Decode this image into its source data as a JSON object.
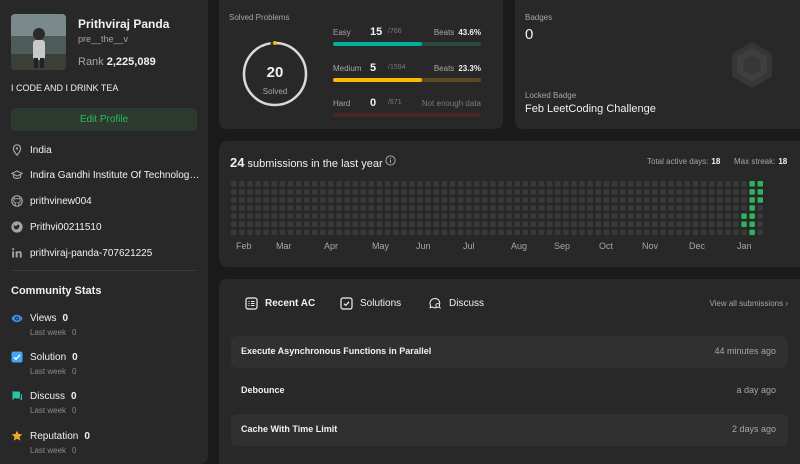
{
  "profile": {
    "name": "Prithviraj Panda",
    "handle": "pre__the__v",
    "rank_label": "Rank",
    "rank_value": "2,225,089",
    "bio": "I CODE AND I DRINK TEA",
    "edit_label": "Edit Profile",
    "location": "India",
    "school": "Indira Gandhi Institute Of Technology...",
    "github": "prithvinew004",
    "twitter": "Prithvi00211510",
    "linkedin": "prithviraj-panda-707621225"
  },
  "community": {
    "title": "Community Stats",
    "stats": [
      {
        "label": "Views",
        "value": "0",
        "sub": "Last week",
        "sub_value": "0",
        "icon": "eye-icon",
        "color": "#3b8ce8"
      },
      {
        "label": "Solution",
        "value": "0",
        "sub": "Last week",
        "sub_value": "0",
        "icon": "checkbox-icon",
        "color": "#42a5f5"
      },
      {
        "label": "Discuss",
        "value": "0",
        "sub": "Last week",
        "sub_value": "0",
        "icon": "chat-icon",
        "color": "#2dc3a5"
      },
      {
        "label": "Reputation",
        "value": "0",
        "sub": "Last week",
        "sub_value": "0",
        "icon": "star-icon",
        "color": "#f5a623"
      }
    ]
  },
  "solved": {
    "title": "Solved Problems",
    "count": "20",
    "label": "Solved",
    "difficulties": [
      {
        "name": "Easy",
        "solved": "15",
        "total": "/766",
        "beats_label": "Beats",
        "beats": "43.6%",
        "fraction": 0.0196,
        "color": "#00af9b",
        "track": "#2a4a3f"
      },
      {
        "name": "Medium",
        "solved": "5",
        "total": "/1594",
        "beats_label": "Beats",
        "beats": "23.3%",
        "fraction": 0.0031,
        "color": "#ffb800",
        "track": "#5a4a1f"
      },
      {
        "name": "Hard",
        "solved": "0",
        "total": "/671",
        "beats_label": "",
        "beats": "Not enough data",
        "fraction": 0,
        "color": "#ef4743",
        "track": "#4a2626"
      }
    ]
  },
  "badges": {
    "title": "Badges",
    "count": "0",
    "locked_label": "Locked Badge",
    "locked_name": "Feb LeetCoding Challenge"
  },
  "submissions": {
    "count": "24",
    "text": "submissions in the last year",
    "active_label": "Total active days:",
    "active_value": "18",
    "streak_label": "Max streak:",
    "streak_value": "18",
    "months": [
      "Feb",
      "Mar",
      "Apr",
      "May",
      "Jun",
      "Jul",
      "Aug",
      "Sep",
      "Oct",
      "Nov",
      "Dec",
      "Jan"
    ],
    "active_color": "#2db55d",
    "empty_color": "#393939"
  },
  "recent": {
    "tabs": [
      {
        "label": "Recent AC",
        "icon": "list-icon"
      },
      {
        "label": "Solutions",
        "icon": "solution-icon"
      },
      {
        "label": "Discuss",
        "icon": "discuss-icon"
      }
    ],
    "view_all": "View all submissions",
    "items": [
      {
        "title": "Execute Asynchronous Functions in Parallel",
        "time": "44 minutes ago"
      },
      {
        "title": "Debounce",
        "time": "a day ago"
      },
      {
        "title": "Cache With Time Limit",
        "time": "2 days ago"
      }
    ]
  }
}
